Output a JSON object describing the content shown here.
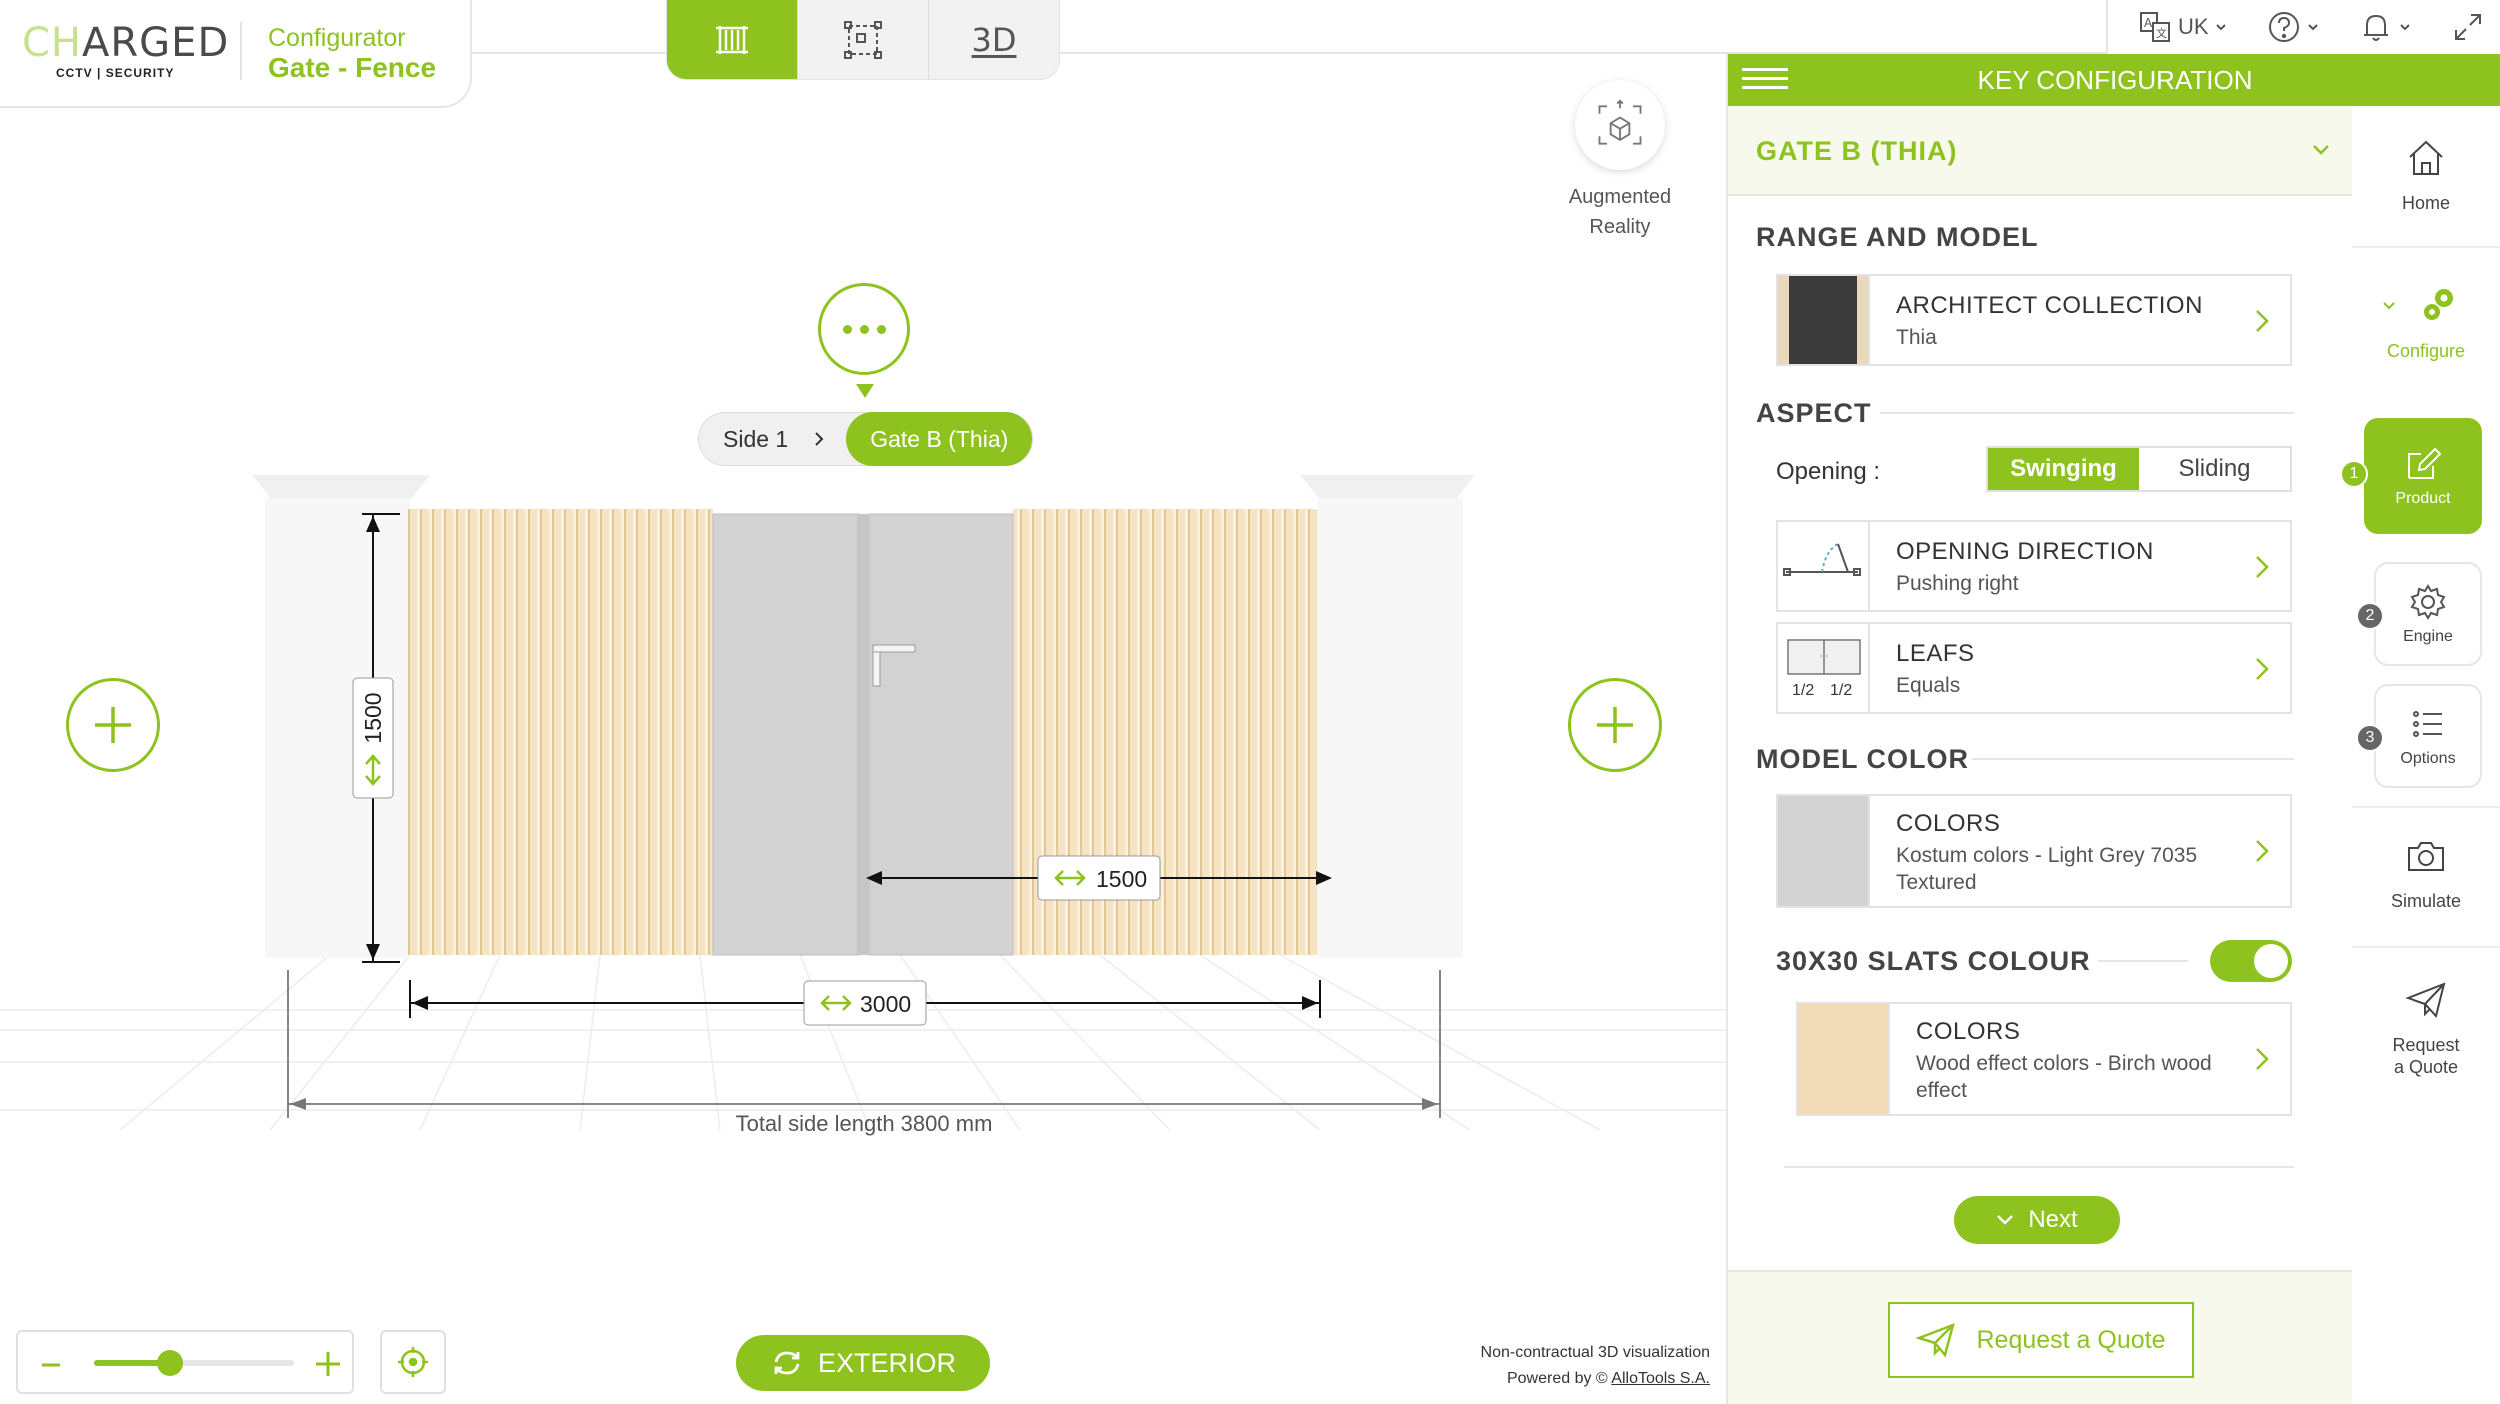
{
  "brand": {
    "logo_part1": "CH",
    "logo_part2": "ARGED",
    "logo_sub": "CCTV | SECURITY",
    "configurator": "Configurator",
    "product": "Gate - Fence"
  },
  "view_tabs": [
    {
      "icon": "fence-view-icon",
      "active": true
    },
    {
      "icon": "plan-view-icon",
      "active": false
    },
    {
      "label": "3D",
      "active": false
    }
  ],
  "utility": {
    "language": "UK",
    "help_icon": "help-icon",
    "notification_icon": "bell-icon",
    "fullscreen_icon": "expand-icon"
  },
  "ar": {
    "label_line1": "Augmented",
    "label_line2": "Reality"
  },
  "breadcrumb": {
    "side": "Side 1",
    "current": "Gate B (Thia)"
  },
  "dimensions": {
    "height": "1500",
    "leaf_width": "1500",
    "gate_width": "3000",
    "total": "Total side length 3800 mm"
  },
  "bottom": {
    "exterior": "EXTERIOR",
    "zoom_level": 0.38,
    "disclaimer_line1": "Non-contractual 3D visualization",
    "disclaimer_line2_prefix": "Powered by © ",
    "disclaimer_link": "AlloTools S.A."
  },
  "panel": {
    "header": "KEY CONFIGURATION",
    "gate_selector": "GATE B (THIA)",
    "range_title": "RANGE AND MODEL",
    "range_card": {
      "title": "ARCHITECT COLLECTION",
      "sub": "Thia"
    },
    "aspect_title": "ASPECT",
    "opening_label": "Opening :",
    "opening_options": [
      "Swinging",
      "Sliding"
    ],
    "opening_selected": "Swinging",
    "direction_card": {
      "title": "OPENING DIRECTION",
      "sub": "Pushing right"
    },
    "leafs_card": {
      "title": "LEAFS",
      "sub": "Equals",
      "thumb_left": "1/2",
      "thumb_right": "1/2"
    },
    "model_color_title": "MODEL COLOR",
    "model_color_card": {
      "title": "COLORS",
      "sub1": "Kostum colors - Light Grey 7035",
      "sub2": "Textured",
      "swatch": "#d3d3d3"
    },
    "slats_title": "30X30 SLATS COLOUR",
    "slats_enabled": true,
    "slats_card": {
      "title": "COLORS",
      "sub1": "Wood effect colors - Birch wood",
      "sub2": "effect",
      "swatch": "#f1dcb7"
    },
    "next": "Next",
    "quote": "Request a Quote"
  },
  "right_nav": {
    "home": "Home",
    "configure": "Configure",
    "product": "Product",
    "engine": "Engine",
    "options": "Options",
    "simulate": "Simulate",
    "request_line1": "Request",
    "request_line2": "a Quote",
    "steps": [
      "1",
      "2",
      "3"
    ]
  },
  "colors": {
    "accent": "#8dc21f",
    "wood": "#f1dcb7",
    "gate_grey": "#d3d3d3"
  }
}
